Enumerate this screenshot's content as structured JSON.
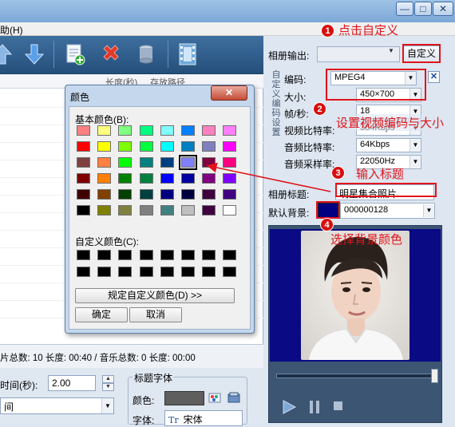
{
  "menubar": {
    "help_fragment": "助(H)"
  },
  "window_controls": {
    "minimize": "—",
    "maximize": "□",
    "close": "✕"
  },
  "list": {
    "col_length": "长度(秒)",
    "col_path": "存放路径"
  },
  "status": {
    "text": "片总数: 10 长度: 00:40 / 音乐总数: 0 长度: 00:00"
  },
  "bottom": {
    "time_label": "时间(秒):",
    "time_value": "2.00",
    "left_select_value": "间",
    "font_group_label": "标题字体",
    "color_label": "颜色:",
    "font_label": "字体:",
    "font_value": "宋体"
  },
  "right": {
    "output_label": "相册输出:",
    "custom_button": "自定义",
    "vertical_label": "自定义编码设置",
    "codec_label": "编码:",
    "codec_value": "MPEG4",
    "size_label": "大小:",
    "size_value": "450×700",
    "fps_label": "帧/秒:",
    "fps_value": "18",
    "video_bitrate_label": "视频比特率:",
    "video_bitrate_value": "384Kbps",
    "audio_bitrate_label": "音频比特率:",
    "audio_bitrate_value": "64Kbps",
    "audio_rate_label": "音频采样率:",
    "audio_rate_value": "22050Hz",
    "album_title_label": "相册标题:",
    "album_title_value": "明星集合照片",
    "default_bg_label": "默认背景:",
    "default_bg_value": "000000128",
    "default_bg_color": "#000080"
  },
  "dialog": {
    "title": "颜色",
    "basic_colors_label": "基本颜色(B):",
    "custom_colors_label": "自定义颜色(C):",
    "define_button": "规定自定义颜色(D) >>",
    "ok_button": "确定",
    "cancel_button": "取消",
    "basic_colors": [
      [
        "#ff8080",
        "#ffff80",
        "#80ff80",
        "#00ff80",
        "#80ffff",
        "#0080ff",
        "#ff80c0",
        "#ff80ff"
      ],
      [
        "#ff0000",
        "#ffff00",
        "#80ff00",
        "#00ff40",
        "#00ffff",
        "#0080c0",
        "#8080c0",
        "#ff00ff"
      ],
      [
        "#804040",
        "#ff8040",
        "#00ff00",
        "#008080",
        "#004080",
        "#8080ff",
        "#800040",
        "#ff0080"
      ],
      [
        "#800000",
        "#ff8000",
        "#008000",
        "#008040",
        "#0000ff",
        "#0000a0",
        "#800080",
        "#8000ff"
      ],
      [
        "#400000",
        "#804000",
        "#004000",
        "#004040",
        "#000080",
        "#000040",
        "#400040",
        "#400080"
      ],
      [
        "#000000",
        "#808000",
        "#808040",
        "#808080",
        "#408080",
        "#c0c0c0",
        "#400040",
        "#ffffff"
      ]
    ]
  },
  "annotations": {
    "a1_num": "1",
    "a1_text": "点击自定义",
    "a2_num": "2",
    "a2_text": "设置视频编码与大小",
    "a3_num": "3",
    "a3_text": "输入标题",
    "a4_num": "4",
    "a4_text": "选择背景颜色"
  }
}
